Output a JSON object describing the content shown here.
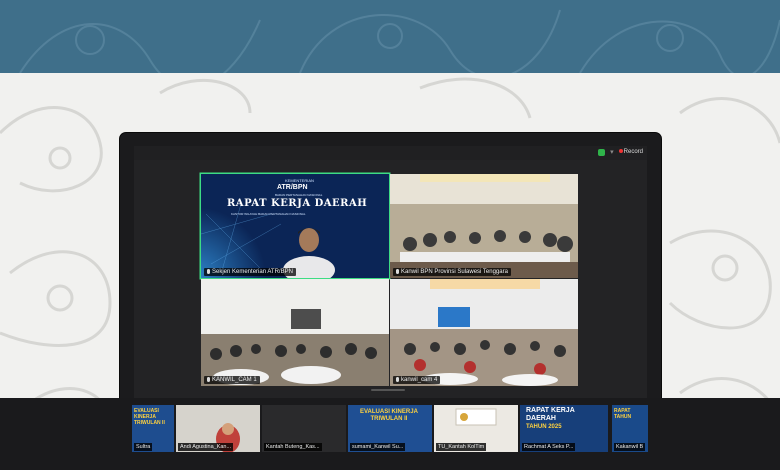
{
  "banner": {
    "color": "#3f6f8a"
  },
  "toolbar": {
    "record_label": "Record"
  },
  "main_tiles": [
    {
      "name": "Sekjen Kementerian ATR/BPN",
      "slide_org_top": "KEMENTERIAN",
      "slide_logo": "ATR/BPN",
      "slide_org_sub": "BADAN PERTANAHAN NASIONAL",
      "slide_title": "RAPAT KERJA DAERAH",
      "slide_sub": "KANTOR WILAYAH BADAN PERTANAHAN NASIONAL"
    },
    {
      "name": "Kanwil BPN Provinsi Sulawesi Tenggara",
      "screen_text": ""
    },
    {
      "name": "KANWIL_CAM 1"
    },
    {
      "name": "kanwil_cam 4"
    }
  ],
  "thumbnails": [
    {
      "name": "Sultra",
      "title_line1": "EVALUASI KINERJA",
      "title_line2": "TRIWULAN II"
    },
    {
      "name": "Andi Agustina_Kan..."
    },
    {
      "name": "Kantah Buteng_Kas..."
    },
    {
      "name": "sumami_Kanwil Su...",
      "title_line1": "EVALUASI KINERJA",
      "title_line2": "TRIWULAN II"
    },
    {
      "name": "TU_Kantah KolTim"
    },
    {
      "name": "Rachmat A Seks P...",
      "title_line1": "RAPAT KERJA",
      "title_line2": "DAERAH",
      "year": "TAHUN 2025"
    },
    {
      "name": "Kakanwil B",
      "title_line1": "RAPAT",
      "title_line2": "TAHUN"
    }
  ]
}
